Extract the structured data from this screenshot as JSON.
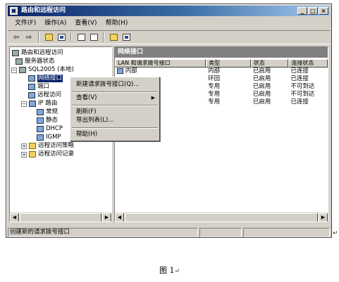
{
  "window": {
    "title": "路由和远程访问",
    "buttons": {
      "minimize": "_",
      "maximize": "□",
      "close": "×"
    }
  },
  "menubar": {
    "items": [
      "文件(F)",
      "操作(A)",
      "查看(V)",
      "帮助(H)"
    ]
  },
  "toolbar": {
    "back": "⇦",
    "forward": "⇨"
  },
  "tree": {
    "root": "路由和远程访问",
    "server_status": "服务器状态",
    "server": "SQL2005 (本地)",
    "network_interfaces": "网络接口",
    "ports": "端口",
    "remote_access_clients": "远程访问",
    "ip_routing": "IP 路由",
    "general": "常规",
    "static_routes": "静态",
    "dhcp": "DHCP",
    "igmp": "IGMP",
    "remote_access_policies": "远程访问策略",
    "remote_access_logging": "远程访问记录"
  },
  "right_pane": {
    "title": "网络接口",
    "columns": [
      "LAN 和请求拨号接口",
      "类型",
      "状态",
      "连接状态"
    ],
    "rows": [
      [
        "内部",
        "内部",
        "已启用",
        "已连接"
      ],
      [
        "",
        "环回",
        "已启用",
        "已连接"
      ],
      [
        "",
        "专用",
        "已启用",
        "不可到达"
      ],
      [
        "",
        "专用",
        "已启用",
        "不可到达"
      ],
      [
        "",
        "专用",
        "已启用",
        "已连接"
      ]
    ]
  },
  "context_menu": {
    "new_demand_dial": "新建请求拨号接口(Q)...",
    "view": "查看(V)",
    "refresh": "刷新(F)",
    "export_list": "导出列表(L)...",
    "help": "帮助(H)"
  },
  "statusbar": {
    "text": "创建新的请求拨号接口"
  },
  "caption": {
    "text": "图 1",
    "mark": "↵"
  },
  "colors": {
    "title_bar": "#0a246a",
    "window_bg": "#d4d0c8",
    "pane_header": "#808080"
  }
}
